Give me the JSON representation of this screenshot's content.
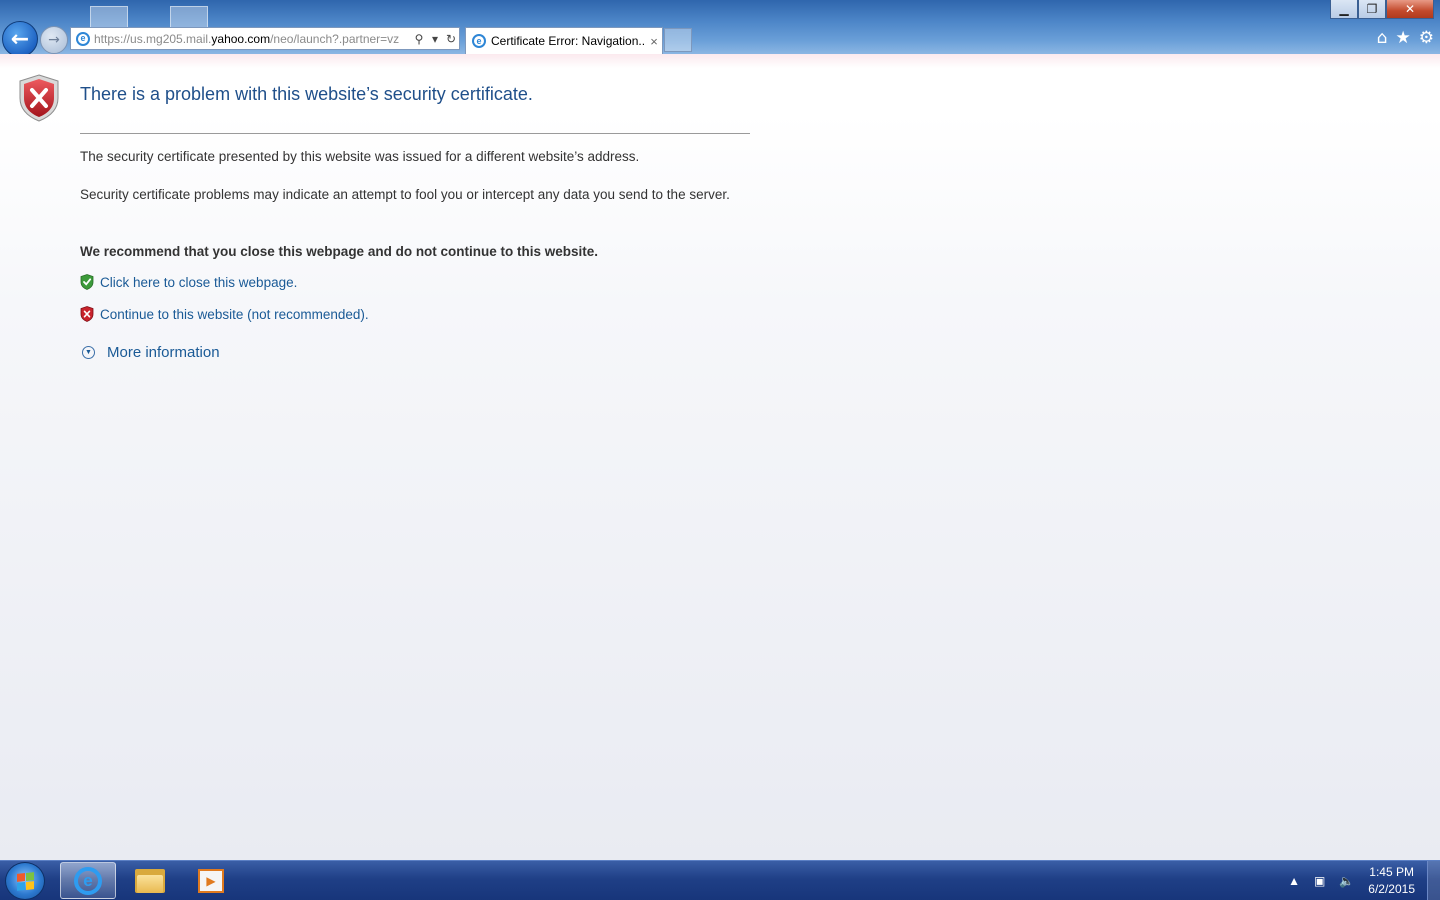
{
  "browser": {
    "address": {
      "url_prefix": "https://us.mg205.mail.",
      "url_host": "yahoo.com",
      "url_suffix": "/neo/launch?.partner=vz"
    },
    "tab": {
      "title": "Certificate Error: Navigation...",
      "close_glyph": "×"
    },
    "window_controls": {
      "minimize": "▁",
      "maximize": "❐",
      "close": "✕"
    },
    "command_icons": {
      "home": "⌂",
      "favorites": "★",
      "tools": "⚙"
    }
  },
  "page": {
    "headline": "There is a problem with this website’s security certificate.",
    "para1": "The security certificate presented by this website was issued for a different website’s address.",
    "para2": "Security certificate problems may indicate an attempt to fool you or intercept any data you send to the server.",
    "recommendation": "We recommend that you close this webpage and do not continue to this website.",
    "close_link": "Click here to close this webpage.",
    "continue_link": "Continue to this website (not recommended).",
    "more_info": "More information"
  },
  "taskbar": {
    "time": "1:45 PM",
    "date": "6/2/2015"
  },
  "colors": {
    "headline": "#1f4f8a",
    "link": "#1a5a96",
    "danger_shield": "#c8232c",
    "safe_shield": "#3c9a3a",
    "taskbar": "#1f3f86"
  }
}
